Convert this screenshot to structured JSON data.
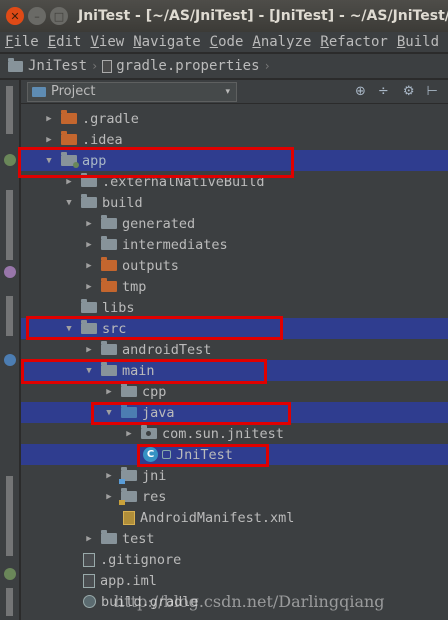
{
  "window": {
    "title": "JniTest - [~/AS/JniTest] - [JniTest] - ~/AS/JniTest/gr",
    "close_glyph": "✕",
    "minimize_glyph": "–",
    "maximize_glyph": "□"
  },
  "menu": [
    "File",
    "Edit",
    "View",
    "Navigate",
    "Code",
    "Analyze",
    "Refactor",
    "Build"
  ],
  "breadcrumb": {
    "project": "JniTest",
    "file": "gradle.properties",
    "separator": "›"
  },
  "panel": {
    "view_selector": "Project",
    "caret": "▾",
    "tools": [
      "⊕",
      "÷",
      "⚙",
      "⊢"
    ]
  },
  "tree": [
    {
      "label": ".gradle",
      "icon": "folder-orange-icon",
      "expanded": false
    },
    {
      "label": ".idea",
      "icon": "folder-orange-icon",
      "expanded": false
    },
    {
      "label": "app",
      "icon": "module-folder-icon",
      "expanded": true,
      "selected": true
    },
    {
      "label": ".externalNativeBuild",
      "icon": "folder-icon",
      "expanded": false
    },
    {
      "label": "build",
      "icon": "folder-icon",
      "expanded": true
    },
    {
      "label": "generated",
      "icon": "folder-icon",
      "expanded": false
    },
    {
      "label": "intermediates",
      "icon": "folder-icon",
      "expanded": false
    },
    {
      "label": "outputs",
      "icon": "folder-orange-icon",
      "expanded": false
    },
    {
      "label": "tmp",
      "icon": "folder-orange-icon",
      "expanded": false
    },
    {
      "label": "libs",
      "icon": "folder-icon"
    },
    {
      "label": "src",
      "icon": "folder-icon",
      "expanded": true,
      "selected": true
    },
    {
      "label": "androidTest",
      "icon": "folder-icon",
      "expanded": false
    },
    {
      "label": "main",
      "icon": "folder-icon",
      "expanded": true,
      "selected": true
    },
    {
      "label": "cpp",
      "icon": "folder-icon",
      "expanded": false
    },
    {
      "label": "java",
      "icon": "source-folder-icon",
      "expanded": true,
      "selected": true
    },
    {
      "label": "com.sun.jnitest",
      "icon": "package-icon",
      "expanded": false
    },
    {
      "label": "JniTest",
      "icon": "class-icon",
      "selected": true
    },
    {
      "label": "jni",
      "icon": "jni-folder-icon",
      "expanded": false
    },
    {
      "label": "res",
      "icon": "res-folder-icon",
      "expanded": false
    },
    {
      "label": "AndroidManifest.xml",
      "icon": "manifest-icon"
    },
    {
      "label": "test",
      "icon": "folder-icon",
      "expanded": false
    },
    {
      "label": ".gitignore",
      "icon": "file-icon"
    },
    {
      "label": "app.iml",
      "icon": "file-icon"
    },
    {
      "label": "build.gradle",
      "icon": "gradle-icon"
    }
  ],
  "class_icon_letter": "C",
  "watermark": "http://blog.csdn.net/Darlingqiang",
  "colors": {
    "selection": "#2f3d8f",
    "highlight_border": "#e00000",
    "background": "#3c3f41"
  }
}
